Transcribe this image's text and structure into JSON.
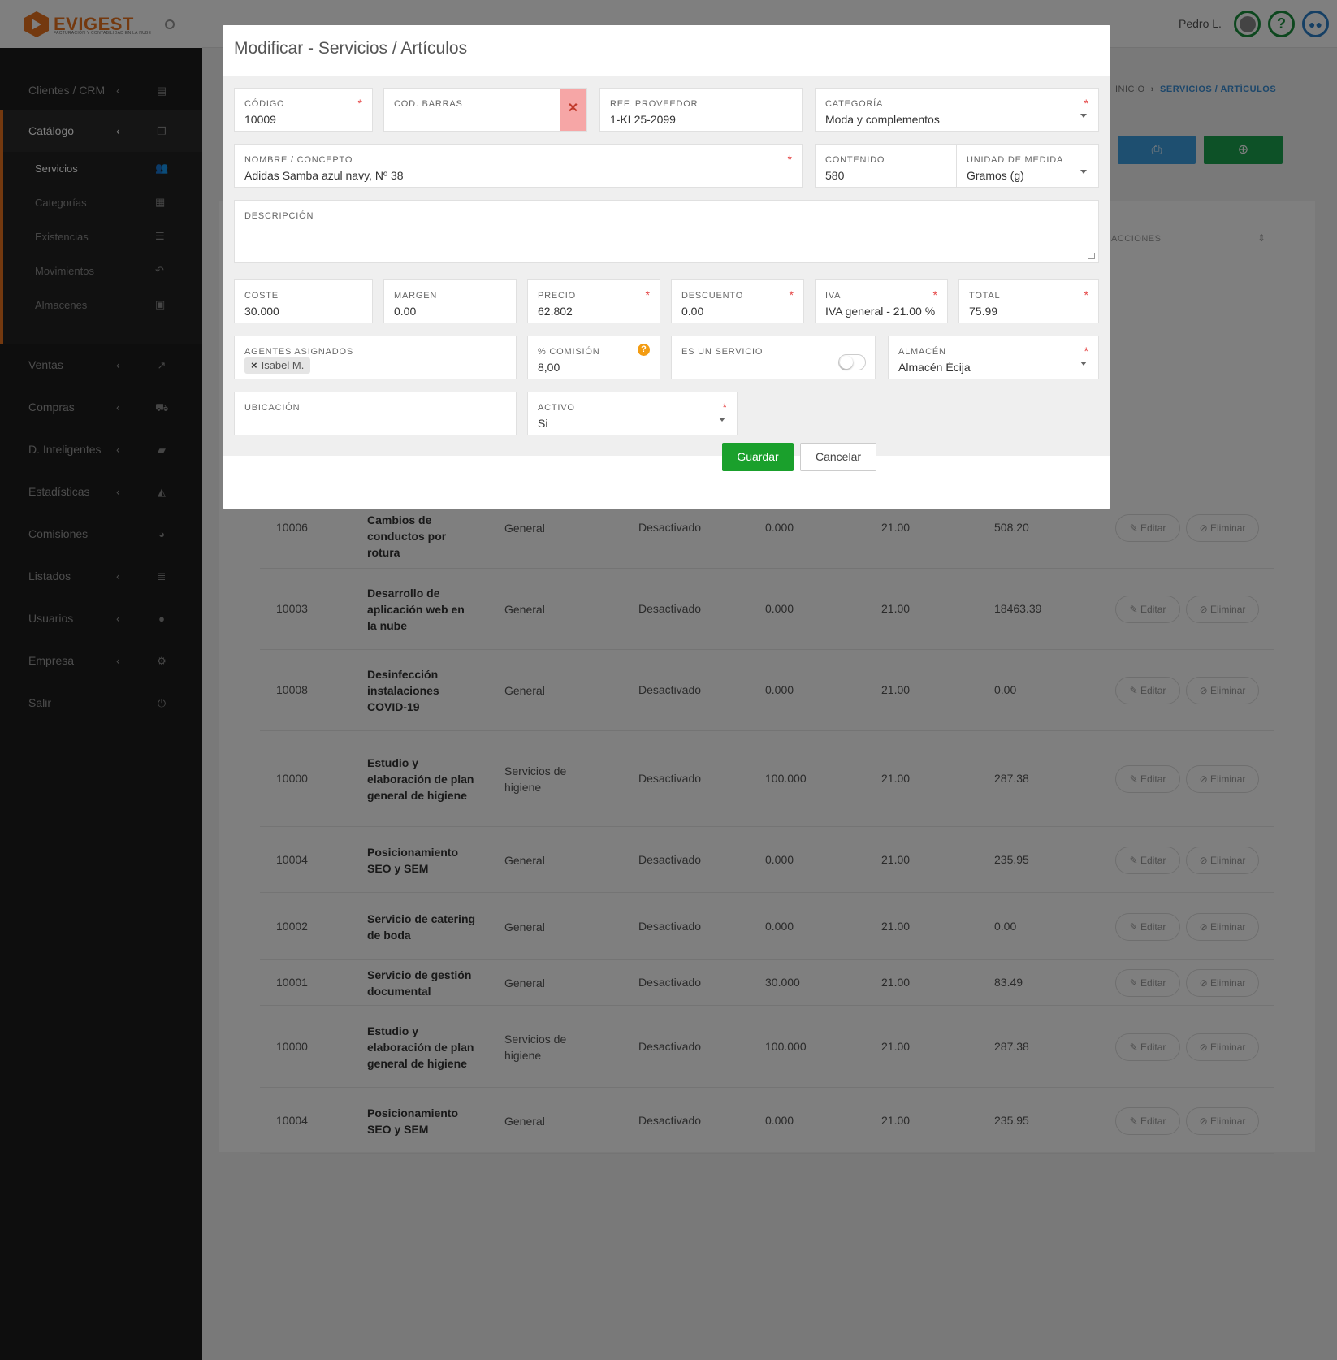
{
  "app": {
    "logo_text": "EVIGEST",
    "logo_sub": "FACTURACIÓN Y CONTABILIDAD EN LA NUBE",
    "user": "Pedro L."
  },
  "sidebar": {
    "items": [
      {
        "label": "Clientes / CRM",
        "icon": "id-card-icon"
      },
      {
        "label": "Catálogo",
        "icon": "copy-icon"
      },
      {
        "label": "Ventas",
        "icon": "chart-line-icon"
      },
      {
        "label": "Compras",
        "icon": "cart-icon"
      },
      {
        "label": "D. Inteligentes",
        "icon": "folder-open-icon"
      },
      {
        "label": "Estadísticas",
        "icon": "area-chart-icon"
      },
      {
        "label": "Comisiones",
        "icon": "pie-chart-icon"
      },
      {
        "label": "Listados",
        "icon": "list-icon"
      },
      {
        "label": "Usuarios",
        "icon": "user-icon"
      },
      {
        "label": "Empresa",
        "icon": "gear-icon"
      },
      {
        "label": "Salir",
        "icon": "power-icon"
      }
    ],
    "sub": [
      {
        "label": "Servicios",
        "icon": "users-icon"
      },
      {
        "label": "Categorías",
        "icon": "archive-icon"
      },
      {
        "label": "Existencias",
        "icon": "list-ol-icon"
      },
      {
        "label": "Movimientos",
        "icon": "undo-icon"
      },
      {
        "label": "Almacenes",
        "icon": "inbox-icon"
      }
    ]
  },
  "breadcrumb": {
    "home": "INICIO",
    "sep": "›",
    "current": "SERVICIOS / ARTÍCULOS"
  },
  "table": {
    "header_actions": "ACCIONES",
    "edit_label": "Editar",
    "delete_label": "Eliminar",
    "rows": [
      {
        "cod": "10006",
        "name": "Cambios de conductos por rotura",
        "cat": "General",
        "estado": "Desactivado",
        "coste": "0.000",
        "iva": "21.00",
        "total": "508.20"
      },
      {
        "cod": "10003",
        "name": "Desarrollo de aplicación web en la nube",
        "cat": "General",
        "estado": "Desactivado",
        "coste": "0.000",
        "iva": "21.00",
        "total": "18463.39"
      },
      {
        "cod": "10008",
        "name": "Desinfección instalaciones COVID-19",
        "cat": "General",
        "estado": "Desactivado",
        "coste": "0.000",
        "iva": "21.00",
        "total": "0.00"
      },
      {
        "cod": "10000",
        "name": "Estudio y elaboración de plan general de higiene",
        "cat": "Servicios de higiene",
        "estado": "Desactivado",
        "coste": "100.000",
        "iva": "21.00",
        "total": "287.38"
      },
      {
        "cod": "10004",
        "name": "Posicionamiento SEO y SEM",
        "cat": "General",
        "estado": "Desactivado",
        "coste": "0.000",
        "iva": "21.00",
        "total": "235.95"
      },
      {
        "cod": "10002",
        "name": "Servicio de catering de boda",
        "cat": "General",
        "estado": "Desactivado",
        "coste": "0.000",
        "iva": "21.00",
        "total": "0.00"
      },
      {
        "cod": "10001",
        "name": "Servicio de gestión documental",
        "cat": "General",
        "estado": "Desactivado",
        "coste": "30.000",
        "iva": "21.00",
        "total": "83.49"
      },
      {
        "cod": "10000",
        "name": "Estudio y elaboración de plan general de higiene",
        "cat": "Servicios de higiene",
        "estado": "Desactivado",
        "coste": "100.000",
        "iva": "21.00",
        "total": "287.38"
      },
      {
        "cod": "10004",
        "name": "Posicionamiento SEO y SEM",
        "cat": "General",
        "estado": "Desactivado",
        "coste": "0.000",
        "iva": "21.00",
        "total": "235.95"
      }
    ]
  },
  "modal": {
    "title": "Modificar - Servicios / Artículos",
    "fields": {
      "codigo": {
        "label": "Código",
        "value": "10009"
      },
      "cod_barras": {
        "label": "Cod. Barras",
        "value": ""
      },
      "ref_proveedor": {
        "label": "Ref. Proveedor",
        "value": "1-KL25-2099"
      },
      "categoria": {
        "label": "Categoría",
        "value": "Moda y complementos"
      },
      "nombre": {
        "label": "Nombre / Concepto",
        "value": "Adidas Samba azul navy, Nº 38"
      },
      "contenido": {
        "label": "Contenido",
        "value": "580"
      },
      "unidad": {
        "label": "Unidad de medida",
        "value": "Gramos (g)"
      },
      "descripcion": {
        "label": "Descripción",
        "value": ""
      },
      "coste": {
        "label": "Coste",
        "value": "30.000"
      },
      "margen": {
        "label": "Margen",
        "value": "0.00"
      },
      "precio": {
        "label": "Precio",
        "value": "62.802"
      },
      "descuento": {
        "label": "Descuento",
        "value": "0.00"
      },
      "iva": {
        "label": "IVA",
        "value": "IVA general - 21.00 %"
      },
      "total": {
        "label": "Total",
        "value": "75.99"
      },
      "agentes": {
        "label": "Agentes asignados",
        "tag": "Isabel M."
      },
      "comision": {
        "label": "% Comisión",
        "value": "8,00"
      },
      "es_servicio": {
        "label": "Es un servicio"
      },
      "almacen": {
        "label": "Almacén",
        "value": "Almacén Écija"
      },
      "ubicacion": {
        "label": "Ubicación",
        "value": ""
      },
      "activo": {
        "label": "Activo",
        "value": "Si"
      }
    },
    "save": "Guardar",
    "cancel": "Cancelar"
  }
}
